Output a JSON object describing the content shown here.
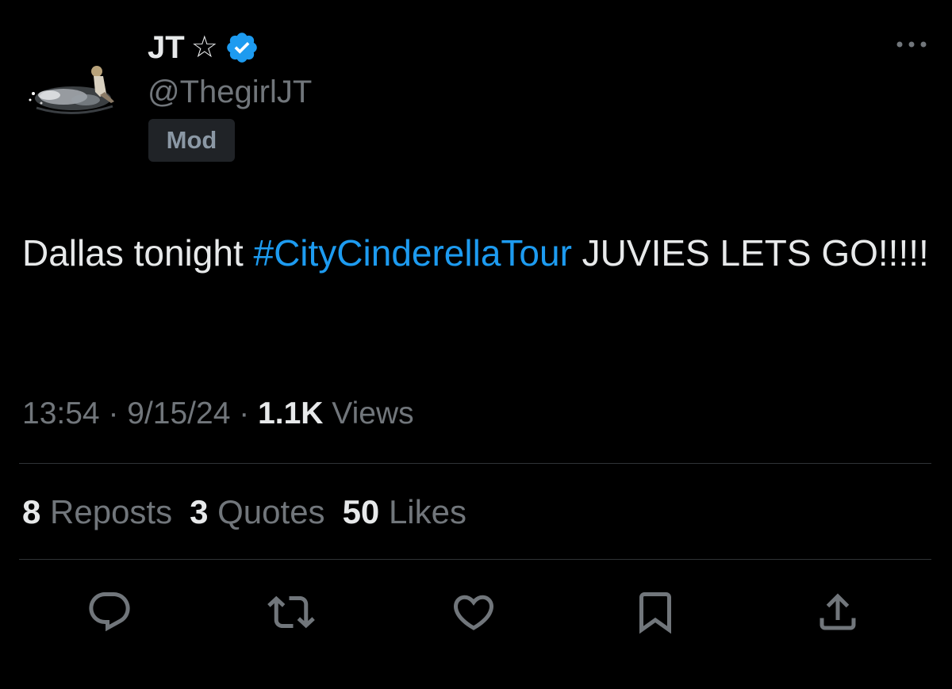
{
  "author": {
    "display_name": "JT",
    "star_glyph": "☆",
    "handle": "@ThegirlJT",
    "badge": "Mod",
    "verified": true
  },
  "tweet": {
    "text_before": "Dallas tonight ",
    "hashtag": "#CityCinderellaTour",
    "text_after": " JUVIES LETS GO!!!!!"
  },
  "meta": {
    "time": "13:54",
    "sep1": " · ",
    "date": "9/15/24",
    "sep2": " · ",
    "views_count": "1.1K",
    "views_label": " Views"
  },
  "stats": {
    "reposts_count": "8",
    "reposts_label": " Reposts",
    "quotes_count": "3",
    "quotes_label": " Quotes",
    "likes_count": "50",
    "likes_label": " Likes"
  },
  "icons": {
    "more": "more-horizontal-icon",
    "verified": "verified-badge-icon",
    "reply": "reply-icon",
    "repost": "repost-icon",
    "like": "like-icon",
    "bookmark": "bookmark-icon",
    "share": "share-icon"
  },
  "colors": {
    "background": "#000000",
    "text": "#e7e9ea",
    "secondary": "#71767b",
    "accent": "#1d9bf0",
    "badge_bg": "#202327",
    "divider": "#2f3336"
  }
}
